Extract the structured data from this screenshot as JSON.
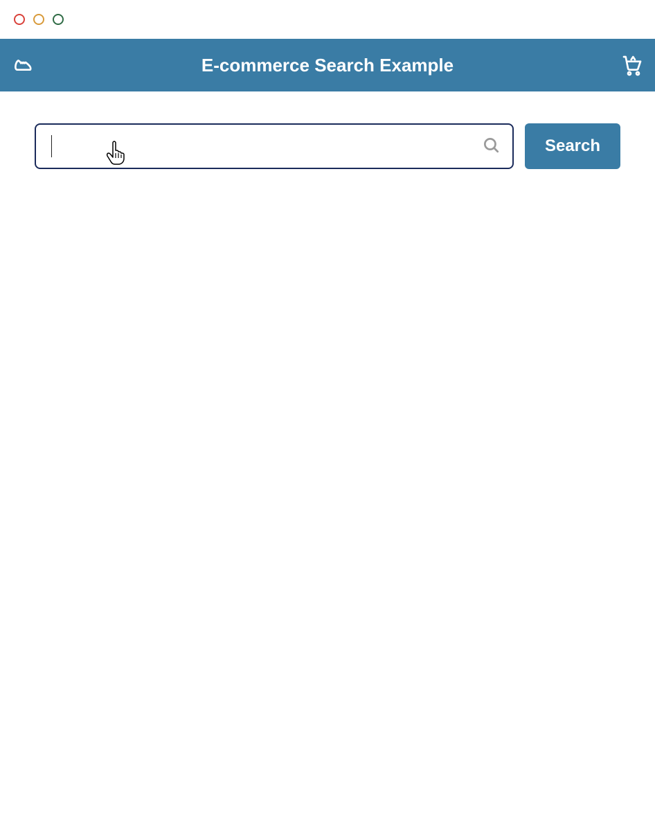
{
  "window": {
    "title": "E-commerce Search Example"
  },
  "header": {
    "title": "E-commerce Search Example"
  },
  "search": {
    "value": "",
    "placeholder": "",
    "button_label": "Search"
  },
  "icons": {
    "leading": "shoe-icon",
    "trailing": "cart-icon",
    "search": "search-icon"
  },
  "colors": {
    "appbar_bg": "#3a7ca5",
    "button_bg": "#3a7ca5",
    "border": "#1a2a5a"
  }
}
